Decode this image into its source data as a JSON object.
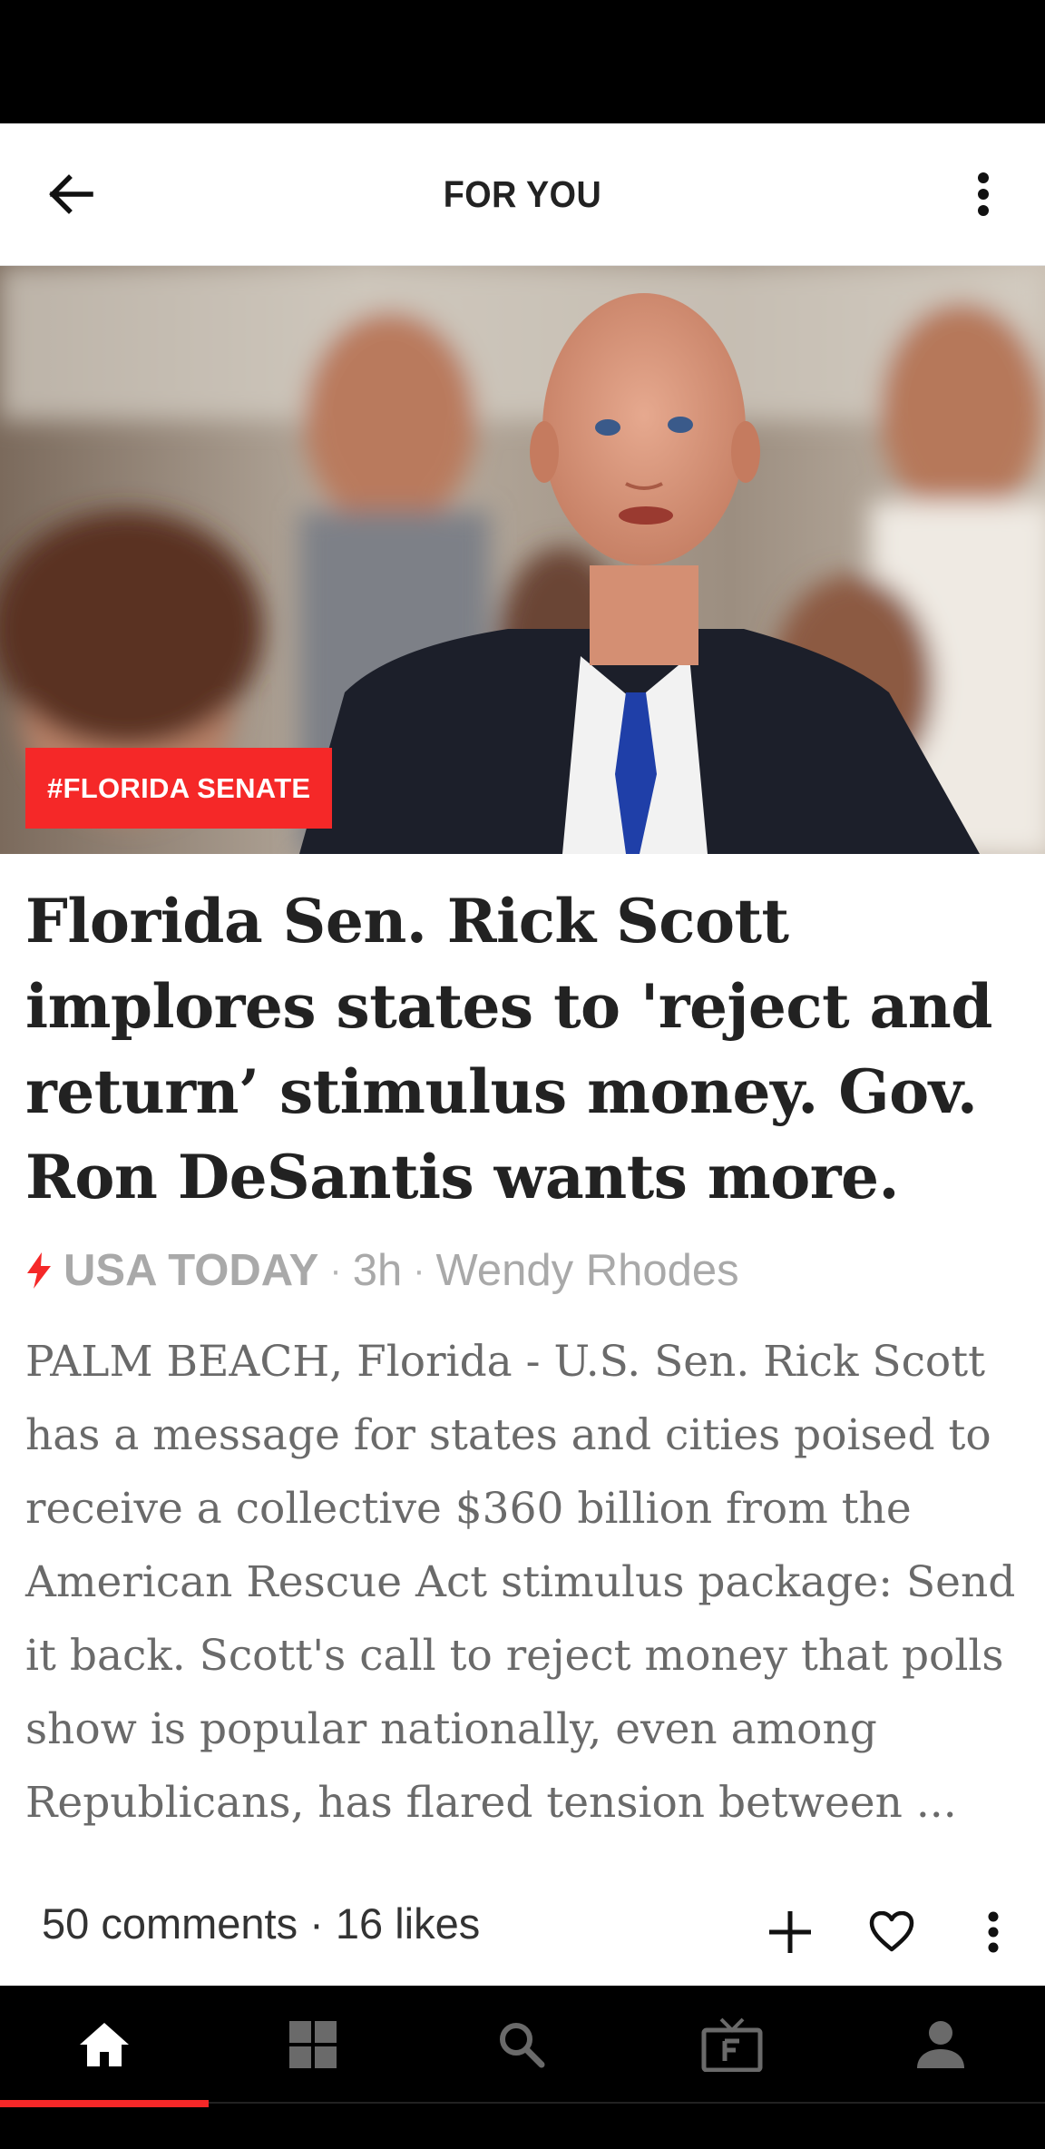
{
  "app_bar": {
    "title": "FOR YOU",
    "back_icon": "arrow-left-icon",
    "more_icon": "vertical-dots-icon"
  },
  "article": {
    "tag": "#FLORIDA SENATE",
    "headline": "Florida Sen. Rick Scott implores states to 'reject and return’ stimulus money. Gov. Ron DeSantis wants more.",
    "source": "USA TODAY",
    "time": "3h",
    "author": "Wendy Rhodes",
    "excerpt": "PALM BEACH, Florida - U.S. Sen. Rick Scott has a message for states and cities poised to receive a collective $360 billion from the American Rescue Act stimulus package: Send it back. Scott's call to reject money that polls show is popular nationally, even among Republicans, has flared tension between ...",
    "stats": "50 comments · 16 likes"
  },
  "bottom_nav": {
    "tabs": [
      "home-icon",
      "grid-icon",
      "search-icon",
      "tv-icon",
      "profile-icon"
    ],
    "active_index": 0
  },
  "colors": {
    "accent": "#f52828",
    "nav_bg": "#000000",
    "meta_text": "#a9a9a9",
    "excerpt_text": "#6a6a6a"
  }
}
